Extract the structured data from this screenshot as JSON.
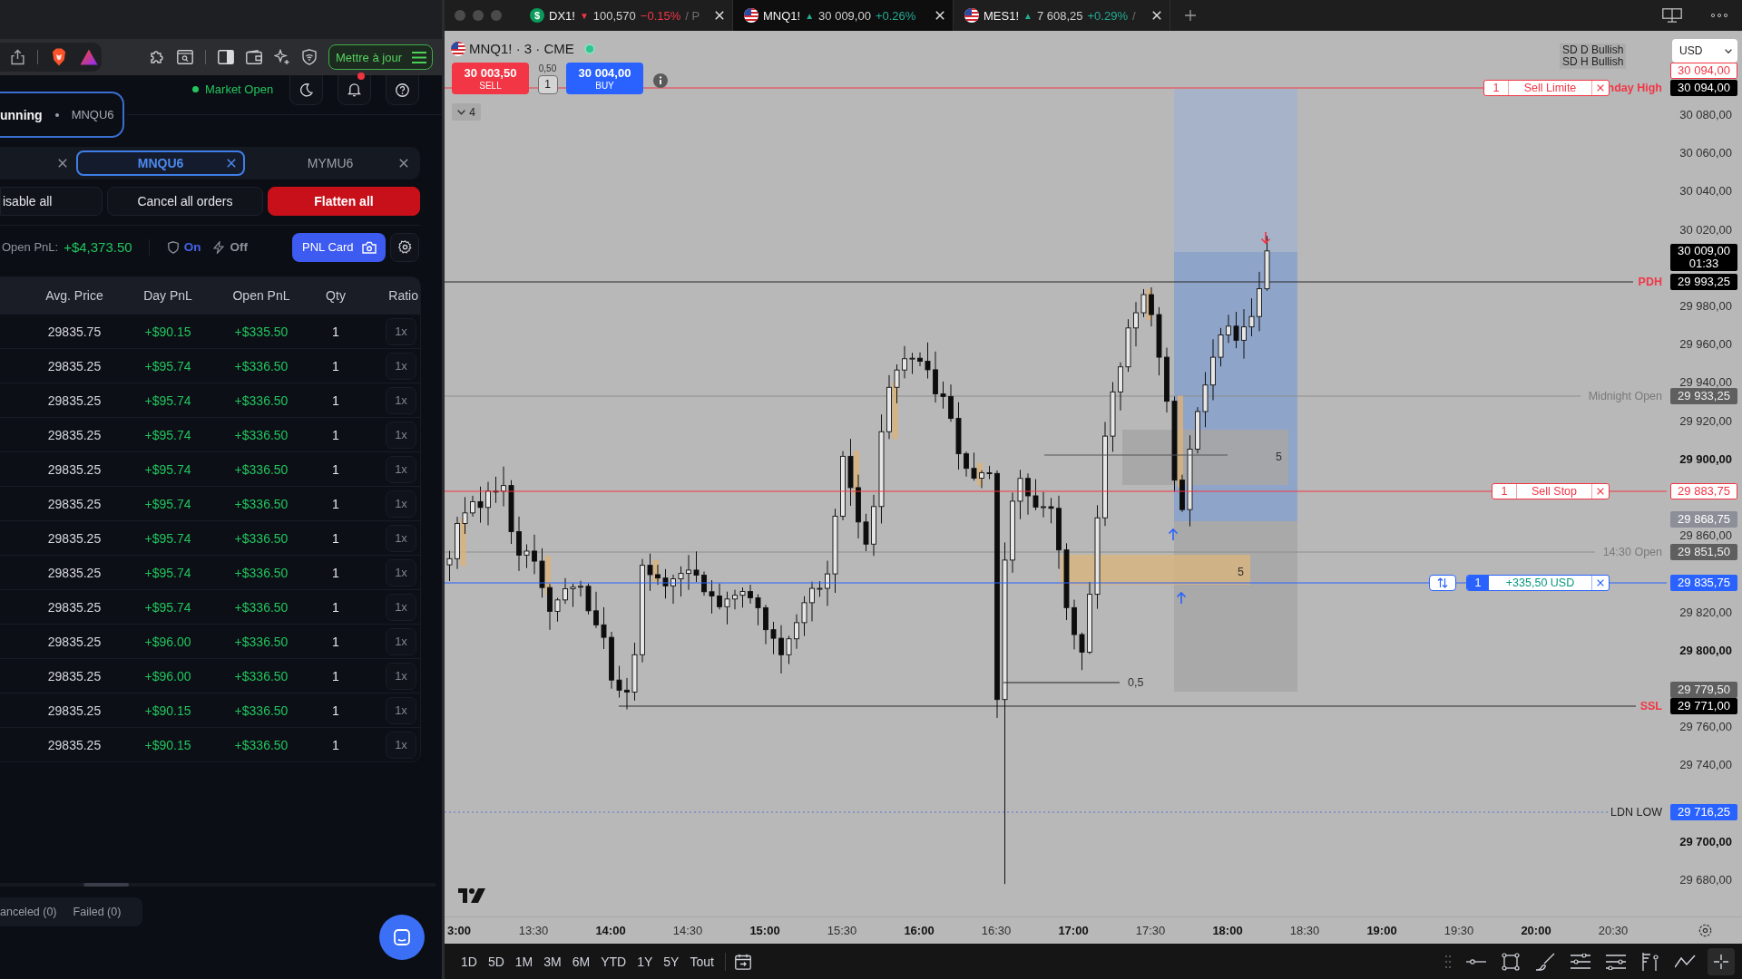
{
  "browser": {
    "tabs": [
      {
        "badge": "$",
        "symbol": "DX1!",
        "kind": "falling",
        "arrow": "▼",
        "price": "100,570",
        "change": "−0.15%",
        "tail": "/ P",
        "selected": false
      },
      {
        "symbol": "MNQ1!",
        "kind": "rising",
        "arrow": "▲",
        "price": "30 009,00",
        "change": "+0.26%",
        "selected": true
      },
      {
        "symbol": "MES1!",
        "kind": "rising",
        "arrow": "▲",
        "price": "7 608,25",
        "change": "+0.29%",
        "tail": "/",
        "selected": false
      }
    ],
    "update_button": "Mettre à jour"
  },
  "trading_panel": {
    "market_status": "Market Open",
    "notifications_unread": true,
    "status_pill": {
      "state": "unning",
      "symbol": "MNQU6"
    },
    "symbol_tabs": [
      {
        "selected": false
      },
      {
        "label": "MNQU6",
        "selected": true
      },
      {
        "label": "MYMU6",
        "selected": false
      }
    ],
    "actions": [
      {
        "kind": "neutral",
        "label": "isable all"
      },
      {
        "kind": "neutral",
        "label": "Cancel all orders"
      },
      {
        "kind": "danger",
        "label": "Flatten all"
      }
    ],
    "open_pnl": {
      "label": "Open PnL:",
      "value": "+$4,373.50"
    },
    "toggles": [
      {
        "kind": "shield",
        "label": "On",
        "selected": true
      },
      {
        "kind": "bolt",
        "label": "Off",
        "selected": false
      }
    ],
    "pnl_card_button": "PNL Card",
    "table": {
      "columns": [
        "Avg. Price",
        "Day PnL",
        "Open PnL",
        "Qty",
        "Ratio"
      ],
      "rows": [
        {
          "avg_price": "29835.75",
          "day_pnl": "+$90.15",
          "open_pnl": "+$335.50",
          "qty": "1",
          "ratio": "1x"
        },
        {
          "avg_price": "29835.25",
          "day_pnl": "+$95.74",
          "open_pnl": "+$336.50",
          "qty": "1",
          "ratio": "1x"
        },
        {
          "avg_price": "29835.25",
          "day_pnl": "+$95.74",
          "open_pnl": "+$336.50",
          "qty": "1",
          "ratio": "1x"
        },
        {
          "avg_price": "29835.25",
          "day_pnl": "+$95.74",
          "open_pnl": "+$336.50",
          "qty": "1",
          "ratio": "1x"
        },
        {
          "avg_price": "29835.25",
          "day_pnl": "+$95.74",
          "open_pnl": "+$336.50",
          "qty": "1",
          "ratio": "1x"
        },
        {
          "avg_price": "29835.25",
          "day_pnl": "+$95.74",
          "open_pnl": "+$336.50",
          "qty": "1",
          "ratio": "1x"
        },
        {
          "avg_price": "29835.25",
          "day_pnl": "+$95.74",
          "open_pnl": "+$336.50",
          "qty": "1",
          "ratio": "1x"
        },
        {
          "avg_price": "29835.25",
          "day_pnl": "+$95.74",
          "open_pnl": "+$336.50",
          "qty": "1",
          "ratio": "1x"
        },
        {
          "avg_price": "29835.25",
          "day_pnl": "+$95.74",
          "open_pnl": "+$336.50",
          "qty": "1",
          "ratio": "1x"
        },
        {
          "avg_price": "29835.25",
          "day_pnl": "+$96.00",
          "open_pnl": "+$336.50",
          "qty": "1",
          "ratio": "1x"
        },
        {
          "avg_price": "29835.25",
          "day_pnl": "+$96.00",
          "open_pnl": "+$336.50",
          "qty": "1",
          "ratio": "1x"
        },
        {
          "avg_price": "29835.25",
          "day_pnl": "+$90.15",
          "open_pnl": "+$336.50",
          "qty": "1",
          "ratio": "1x"
        },
        {
          "avg_price": "29835.25",
          "day_pnl": "+$90.15",
          "open_pnl": "+$336.50",
          "qty": "1",
          "ratio": "1x"
        }
      ]
    },
    "filters": [
      "anceled (0)",
      "Failed (0)"
    ]
  },
  "chart": {
    "title": "MNQ1! · 3 · CME",
    "sell": {
      "price": "30 003,50",
      "label": "SELL"
    },
    "spread": "0,50",
    "quantity": "1",
    "buy": {
      "price": "30 004,00",
      "label": "BUY"
    },
    "indicators_count": "4",
    "legend": [
      "SD D Bullish",
      "SD H Bullish"
    ],
    "currency": "USD",
    "order_labels": [
      {
        "kind": "order",
        "quantity": "1",
        "label": "Sell Limite"
      },
      {
        "kind": "order",
        "quantity": "1",
        "label": "Sell Stop"
      },
      {
        "kind": "position",
        "quantity": "1",
        "label": "+335,50 USD"
      }
    ],
    "level_labels": [
      {
        "kind": "key",
        "text": "nday High"
      },
      {
        "kind": "key",
        "text": "PDH"
      },
      {
        "kind": "session",
        "text": "Midnight Open"
      },
      {
        "kind": "session",
        "text": "14:30 Open"
      },
      {
        "kind": "key",
        "text": "SSL"
      },
      {
        "kind": "plain",
        "text": "LDN LOW"
      }
    ],
    "zone_labels": [
      "5",
      "5",
      "0,5"
    ],
    "price_ticks": [
      {
        "label": "30 080,00",
        "major": false
      },
      {
        "label": "30 060,00",
        "major": false
      },
      {
        "label": "30 040,00",
        "major": false
      },
      {
        "label": "30 020,00",
        "major": false
      },
      {
        "label": "29 980,00",
        "major": false
      },
      {
        "label": "29 960,00",
        "major": false
      },
      {
        "label": "29 940,00",
        "major": false
      },
      {
        "label": "29 920,00",
        "major": false
      },
      {
        "label": "29 900,00",
        "major": true
      },
      {
        "label": "29 860,00",
        "major": false
      },
      {
        "label": "29 820,00",
        "major": false
      },
      {
        "label": "29 800,00",
        "major": true
      },
      {
        "label": "29 760,00",
        "major": false
      },
      {
        "label": "29 740,00",
        "major": false
      },
      {
        "label": "29 700,00",
        "major": true
      },
      {
        "label": "29 680,00",
        "major": false
      }
    ],
    "price_tags": [
      {
        "kind": "order",
        "text": "30 094,00"
      },
      {
        "kind": "level",
        "text": "30 094,00"
      },
      {
        "kind": "last",
        "text": "30 009,00",
        "countdown": "01:33"
      },
      {
        "kind": "level",
        "text": "29 993,25"
      },
      {
        "kind": "session",
        "text": "29 933,25"
      },
      {
        "kind": "order",
        "text": "29 883,75"
      },
      {
        "kind": "marker",
        "text": "29 868,75"
      },
      {
        "kind": "session",
        "text": "29 851,50"
      },
      {
        "kind": "position",
        "text": "29 835,75"
      },
      {
        "kind": "session",
        "text": "29 779,50"
      },
      {
        "kind": "level",
        "text": "29 771,00"
      },
      {
        "kind": "position",
        "text": "29 716,25"
      }
    ],
    "time_ticks": [
      {
        "label": "3:00",
        "major": true
      },
      {
        "label": "13:30",
        "major": false
      },
      {
        "label": "14:00",
        "major": true
      },
      {
        "label": "14:30",
        "major": false
      },
      {
        "label": "15:00",
        "major": true
      },
      {
        "label": "15:30",
        "major": false
      },
      {
        "label": "16:00",
        "major": true
      },
      {
        "label": "16:30",
        "major": false
      },
      {
        "label": "17:00",
        "major": true
      },
      {
        "label": "17:30",
        "major": false
      },
      {
        "label": "18:00",
        "major": true
      },
      {
        "label": "18:30",
        "major": false
      },
      {
        "label": "19:00",
        "major": true
      },
      {
        "label": "19:30",
        "major": false
      },
      {
        "label": "20:00",
        "major": true
      },
      {
        "label": "20:30",
        "major": false
      }
    ],
    "timeframes": [
      "1D",
      "5D",
      "1M",
      "3M",
      "6M",
      "YTD",
      "1Y",
      "5Y",
      "Tout"
    ]
  }
}
